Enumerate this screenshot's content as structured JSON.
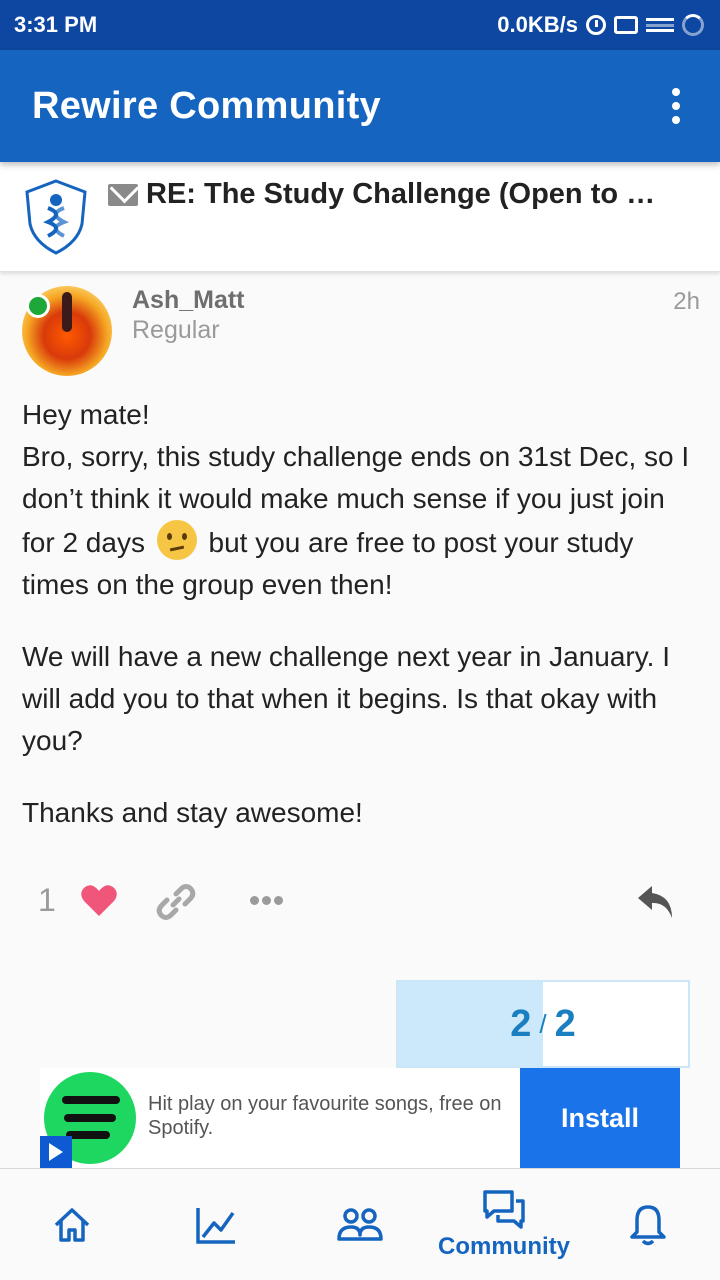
{
  "status_bar": {
    "time": "3:31 PM",
    "net_speed": "0.0KB/s",
    "icons": [
      "alarm-icon",
      "sim-icon",
      "signal-bars-icon",
      "loading-icon"
    ]
  },
  "app_bar": {
    "title": "Rewire Community",
    "menu_icon": "more-vertical-icon"
  },
  "topic": {
    "title": "RE: The Study Challenge (Open to U...",
    "type_icon": "mail-icon",
    "participants": [
      "phoenix-avatar",
      "silhouette-avatar"
    ]
  },
  "post": {
    "username": "Ash_Matt",
    "rank": "Regular",
    "time": "2h",
    "online": true,
    "body": {
      "p1_line1": "Hey mate!",
      "p1_a": "Bro, sorry, this study challenge ends on 31st Dec, so I don’t think it would make much sense if you just join for 2 days",
      "p1_emoji": "confused-face",
      "p1_b": "but you are free to post your study times on the group even then!",
      "p2": "We will have a new challenge next year in January. I will add you to that when it begins. Is that okay with you?",
      "p3": "Thanks and stay awesome!"
    },
    "actions": {
      "like_count": "1",
      "like_color": "#f0567a"
    }
  },
  "pager": {
    "current": "2",
    "separator": "/",
    "total": "2",
    "progress": 0.5
  },
  "ad": {
    "advertiser": "Spotify",
    "text": "Hit play on your favourite songs, free on Spotify.",
    "cta": "Install"
  },
  "bottom_nav": {
    "items": [
      {
        "icon": "home-icon",
        "label": ""
      },
      {
        "icon": "chart-icon",
        "label": ""
      },
      {
        "icon": "people-icon",
        "label": ""
      },
      {
        "icon": "chat-bubbles-icon",
        "label": "Community",
        "active": true
      },
      {
        "icon": "bell-icon",
        "label": ""
      }
    ]
  },
  "colors": {
    "status_bar": "#0d47a1",
    "app_bar": "#1565c0",
    "accent": "#1565c0",
    "pager_text": "#1a7fc1",
    "install_button": "#1a73e8",
    "spotify_green": "#1ed760"
  }
}
